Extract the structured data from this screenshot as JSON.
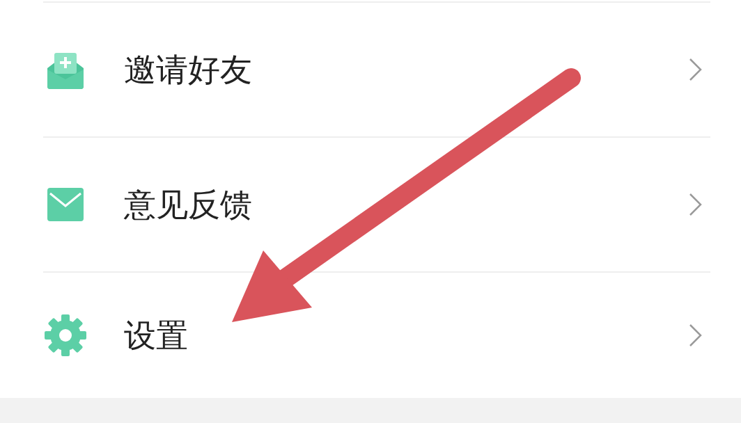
{
  "menu": [
    {
      "label": "邀请好友"
    },
    {
      "label": "意见反馈"
    },
    {
      "label": "设置"
    }
  ]
}
